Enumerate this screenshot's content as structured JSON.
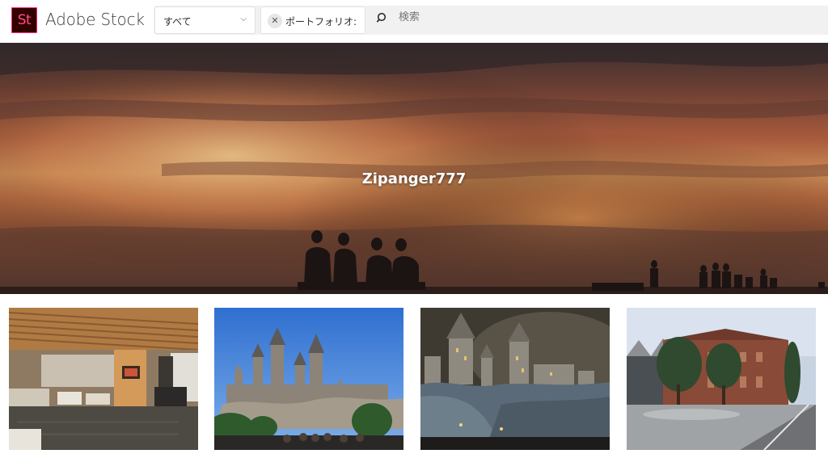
{
  "header": {
    "logo_text": "St",
    "brand": "Adobe Stock",
    "scope_select": {
      "value": "すべて"
    },
    "filter_chip": {
      "label": "ポートフォリオ:"
    },
    "search": {
      "placeholder": "検索"
    }
  },
  "hero": {
    "contributor_name": "Zipanger777"
  },
  "thumbnails": [
    {
      "subject": "lounge-interior"
    },
    {
      "subject": "castle-day"
    },
    {
      "subject": "castle-night"
    },
    {
      "subject": "brick-building"
    }
  ],
  "colors": {
    "logo_bg": "#330000",
    "logo_accent": "#ff2b7a",
    "search_bar_bg": "#f1f1f1"
  }
}
